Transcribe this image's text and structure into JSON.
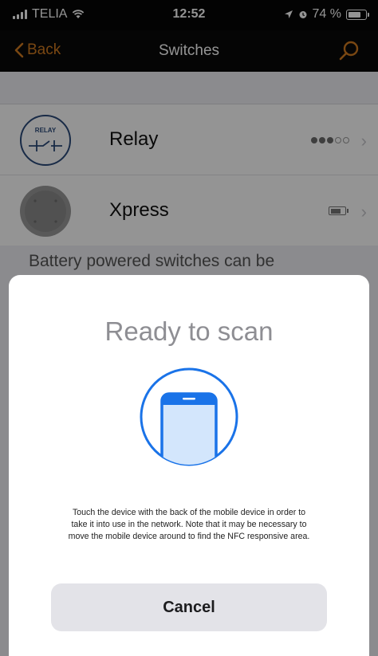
{
  "status_bar": {
    "carrier": "TELIA",
    "time": "12:52",
    "battery_text": "74 %",
    "battery_level": 0.74
  },
  "nav": {
    "back_label": "Back",
    "title": "Switches"
  },
  "switches": [
    {
      "icon_text": "RELAY",
      "name": "Relay",
      "signal_filled": 3,
      "signal_total": 5
    },
    {
      "name": "Xpress",
      "battery_indicator": "battery-icon"
    }
  ],
  "info_text": "Battery powered switches can be",
  "nfc_sheet": {
    "title": "Ready to scan",
    "description_lines": [
      "Touch the device with the back of the mobile device in order to",
      "take it into use in the network. Note that it may be necessary to",
      "move the mobile device around to find the NFC responsive area."
    ],
    "cancel_label": "Cancel"
  },
  "colors": {
    "accent": "#d17a1f",
    "nfc_blue": "#1a73e8",
    "nav_background": "#0a0a0a"
  }
}
